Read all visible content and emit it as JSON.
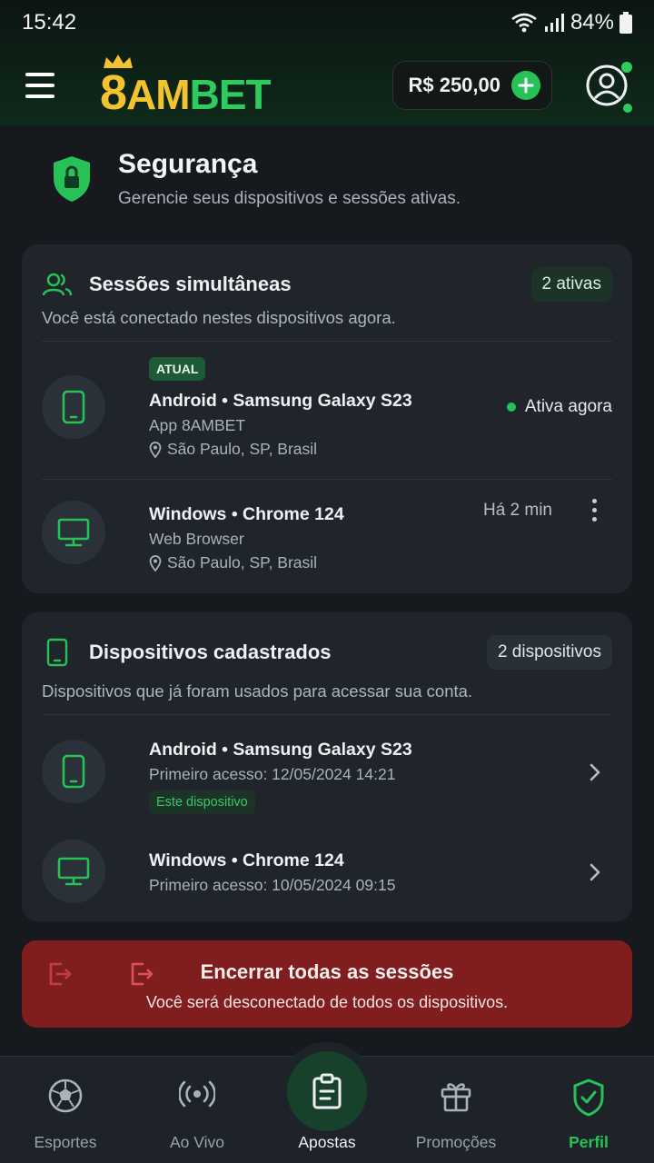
{
  "status_bar": {
    "time": "15:42",
    "battery": "84%"
  },
  "header": {
    "logo": {
      "part1": "8",
      "part2": "AM",
      "part3": "BET"
    },
    "balance": "R$ 250,00"
  },
  "security": {
    "title": "Segurança",
    "subtitle": "Gerencie seus dispositivos e sessões ativas."
  },
  "sessions": {
    "title": "Sessões simultâneas",
    "count_badge": "2 ativas",
    "description": "Você está conectado nestes dispositivos agora.",
    "items": [
      {
        "badge": "ATUAL",
        "title": "Android • Samsung Galaxy S23",
        "client": "App 8AMBET",
        "location": "São Paulo, SP, Brasil",
        "status": "Ativa agora"
      },
      {
        "title": "Windows • Chrome 124",
        "client": "Web Browser",
        "location": "São Paulo, SP, Brasil",
        "last_seen": "Há 2 min"
      }
    ]
  },
  "devices": {
    "title": "Dispositivos cadastrados",
    "count_badge": "2 dispositivos",
    "description": "Dispositivos que já foram usados para acessar sua conta.",
    "items": [
      {
        "title": "Android • Samsung Galaxy S23",
        "first_access": "Primeiro acesso: 12/05/2024 14:21",
        "badge": "Este dispositivo"
      },
      {
        "title": "Windows • Chrome 124",
        "first_access": "Primeiro acesso: 10/05/2024 09:15"
      }
    ]
  },
  "end_all": {
    "title": "Encerrar todas as sessões",
    "subtitle": "Você será desconectado de todos os dispositivos."
  },
  "bottom_nav": [
    {
      "label": "Esportes",
      "icon": "soccer-ball-icon"
    },
    {
      "label": "Ao Vivo",
      "icon": "live-broadcast-icon"
    },
    {
      "label": "Apostas",
      "icon": "clipboard-icon"
    },
    {
      "label": "Promoções",
      "icon": "gift-icon"
    },
    {
      "label": "Perfil",
      "icon": "shield-check-icon",
      "active": true
    }
  ],
  "colors": {
    "accent_green": "#27c257",
    "brand_gold": "#f2c230",
    "danger_red": "#801d1f",
    "background": "#161a1e",
    "card": "#1f252b"
  }
}
